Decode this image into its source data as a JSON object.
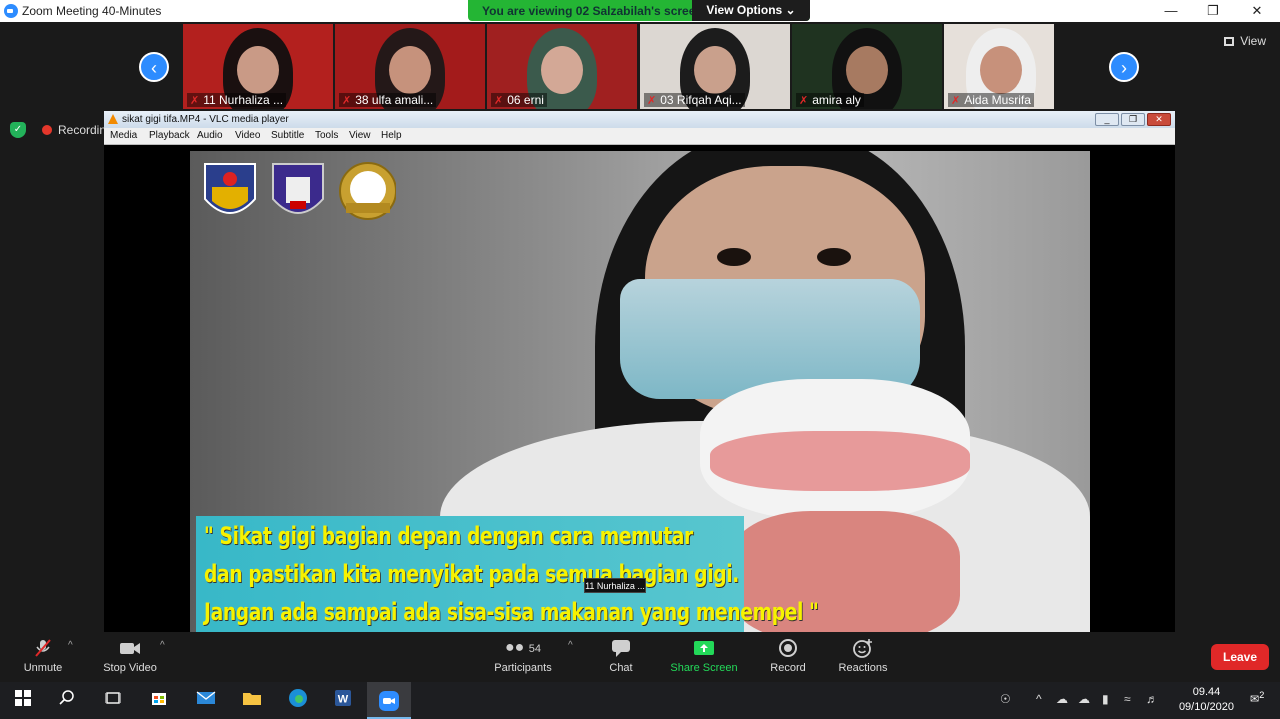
{
  "window": {
    "title": "Zoom Meeting 40-Minutes",
    "viewing_banner": "You are viewing 02 Salzabilah's screen",
    "view_options": "View Options ⌄",
    "minimize": "—",
    "restore": "❐",
    "close": "✕"
  },
  "gallery": {
    "prev": "‹",
    "next": "›",
    "view_label": "View",
    "tiles": [
      {
        "name": "11 Nurhaliza ...",
        "bg": "#b3201e",
        "hijab": "#1a1010",
        "skin": "#c99a86"
      },
      {
        "name": "38 ulfa amali...",
        "bg": "#a31b1b",
        "hijab": "#241818",
        "skin": "#c6927c"
      },
      {
        "name": "06 erni",
        "bg": "#a02020",
        "hijab": "#3b5a4c",
        "skin": "#d3a896"
      },
      {
        "name": "03 Rifqah Aqi...",
        "bg": "#dcd7d2",
        "hijab": "#1c1c1c",
        "skin": "#c9a08c"
      },
      {
        "name": "amira aly",
        "bg": "#1f3320",
        "hijab": "#111111",
        "skin": "#a77a61"
      },
      {
        "name": "Aida Musrifa",
        "bg": "#e6e0da",
        "hijab": "#eeeeee",
        "skin": "#c7917b"
      }
    ]
  },
  "status": {
    "recording": "Recording"
  },
  "vlc": {
    "title": "sikat gigi tifa.MP4 - VLC media player",
    "menu": [
      "Media",
      "Playback",
      "Audio",
      "Video",
      "Subtitle",
      "Tools",
      "View",
      "Help"
    ],
    "caption_lines": [
      "\" Sikat gigi bagian depan dengan cara memutar",
      "dan pastikan kita menyikat pada semua bagian gigi.",
      "Jangan ada sampai ada sisa-sisa makanan yang menempel \""
    ],
    "speaker_tooltip": "11 Nurhaliza ..."
  },
  "controls": {
    "unmute": "Unmute",
    "stop_video": "Stop Video",
    "participants": "Participants",
    "participants_count": "54",
    "chat": "Chat",
    "share_screen": "Share Screen",
    "record": "Record",
    "reactions": "Reactions",
    "leave": "Leave"
  },
  "taskbar": {
    "time": "09.44",
    "date": "09/10/2020",
    "notifications": "2"
  },
  "colors": {
    "zoom_blue": "#2d8cff",
    "share_green": "#23d959",
    "leave_red": "#e02828",
    "banner_green": "#24b534"
  }
}
